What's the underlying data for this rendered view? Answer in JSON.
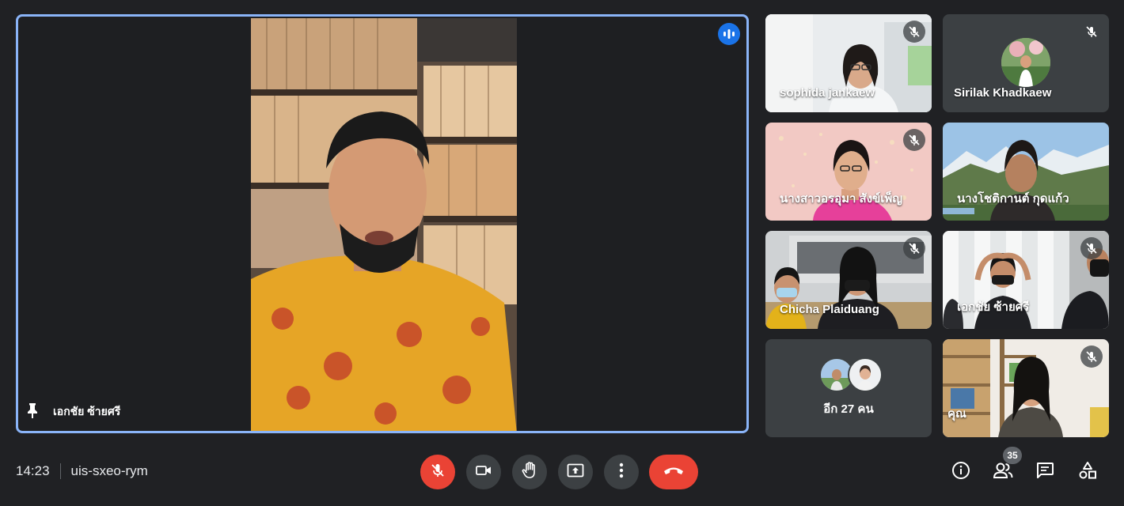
{
  "main_speaker": {
    "name": "เอกชัย ซ้ายศรี"
  },
  "participants": [
    {
      "name": "sophida jankaew",
      "muted": true
    },
    {
      "name": "Sirilak Khadkaew",
      "muted": true
    },
    {
      "name": "นางสาวอรอุมา สังข์เพ็ญ",
      "muted": true
    },
    {
      "name": "นางโชติกานต์ กุดแก้ว",
      "muted": false
    },
    {
      "name": "Chicha Plaiduang",
      "muted": true
    },
    {
      "name": "เอกชัย ซ้ายศรี",
      "muted": true
    },
    {
      "name": "อีก 27 คน",
      "muted": false
    },
    {
      "name": "คุณ",
      "muted": true
    }
  ],
  "meeting": {
    "time": "14:23",
    "code": "uis-sxeo-rym"
  },
  "people_count": "35",
  "colors": {
    "background": "#202124",
    "active_border": "#8ab4f8",
    "danger": "#ea4335",
    "control_bg": "#3c4043"
  }
}
